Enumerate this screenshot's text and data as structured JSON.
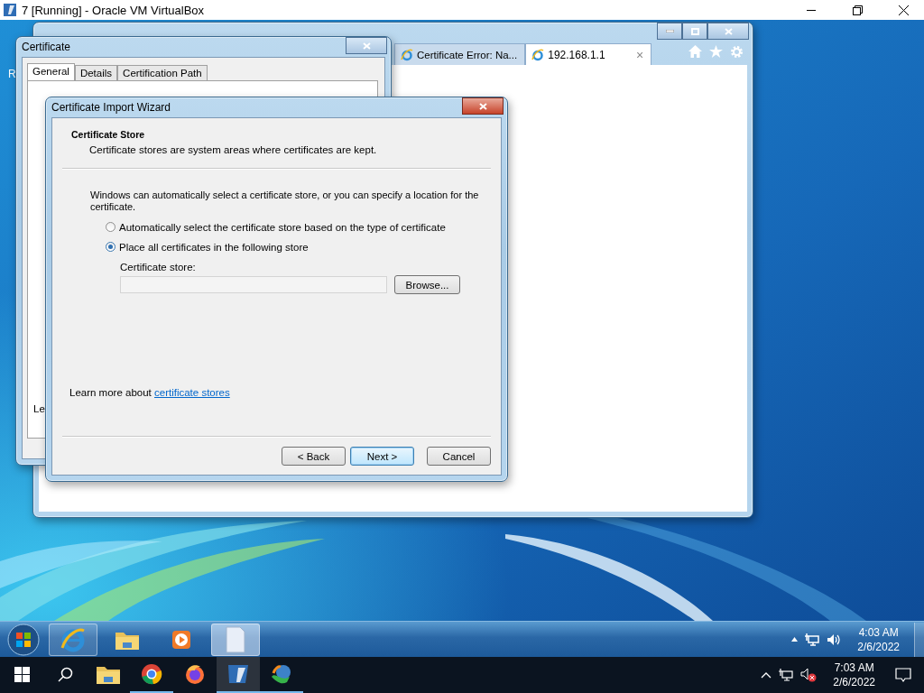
{
  "host_window": {
    "title": "7 [Running] - Oracle VM VirtualBox"
  },
  "desktop": {
    "icon_label_fragment": "R"
  },
  "browser": {
    "tabs": [
      {
        "label": "Certificate Error: Na...",
        "selected": false
      },
      {
        "label": "192.168.1.1",
        "selected": true
      }
    ],
    "tab_close": "×"
  },
  "certificate_dialog": {
    "title": "Certificate",
    "tabs": [
      {
        "label": "General",
        "selected": true
      },
      {
        "label": "Details",
        "selected": false
      },
      {
        "label": "Certification Path",
        "selected": false
      }
    ],
    "body_fragment": "Le"
  },
  "wizard": {
    "title": "Certificate Import Wizard",
    "header_title": "Certificate Store",
    "header_subtitle": "Certificate stores are system areas where certificates are kept.",
    "intro": "Windows can automatically select a certificate store, or you can specify a location for the certificate.",
    "options": [
      {
        "label": "Automatically select the certificate store based on the type of certificate",
        "selected": false
      },
      {
        "label": "Place all certificates in the following store",
        "selected": true
      }
    ],
    "store_label": "Certificate store:",
    "browse_button": "Browse...",
    "learn_more": "Learn more about",
    "learn_more_link": "certificate stores",
    "buttons": [
      {
        "label": "< Back",
        "default": false
      },
      {
        "label": "Next >",
        "default": true
      },
      {
        "label": "Cancel",
        "default": false
      }
    ]
  },
  "guest_taskbar": {
    "items": [
      {
        "kind": "ie",
        "running": true,
        "selected": false
      },
      {
        "kind": "explorer",
        "running": false,
        "selected": false
      },
      {
        "kind": "media",
        "running": false,
        "selected": false
      },
      {
        "kind": "document",
        "running": true,
        "selected": true
      }
    ],
    "time": "4:03 AM",
    "date": "2/6/2022"
  },
  "host_taskbar": {
    "items": [
      {
        "kind": "explorer",
        "running": false,
        "selected": false
      },
      {
        "kind": "chrome",
        "running": true,
        "selected": false
      },
      {
        "kind": "firefox",
        "running": false,
        "selected": false
      },
      {
        "kind": "virtualbox",
        "running": true,
        "selected": true
      },
      {
        "kind": "download",
        "running": true,
        "selected": false
      }
    ],
    "time": "7:03 AM",
    "date": "2/6/2022"
  }
}
